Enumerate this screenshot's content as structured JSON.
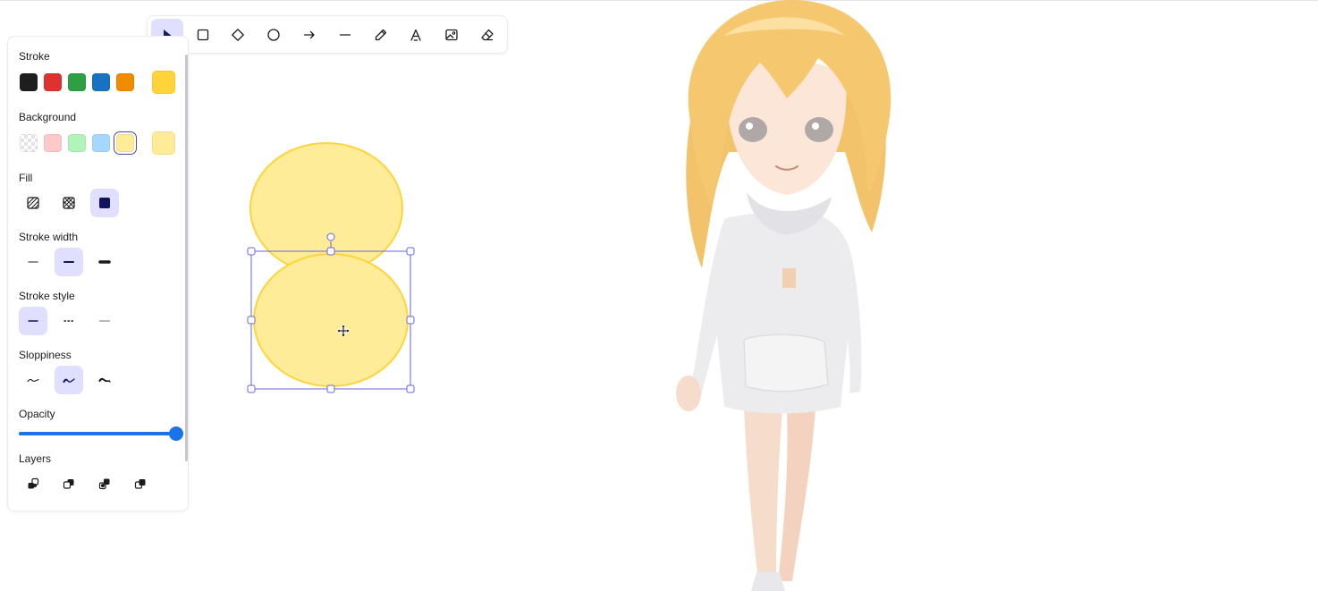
{
  "toolbar": {
    "tools": [
      {
        "name": "selection-icon",
        "active": true
      },
      {
        "name": "rectangle-icon"
      },
      {
        "name": "diamond-icon"
      },
      {
        "name": "ellipse-icon"
      },
      {
        "name": "arrow-icon"
      },
      {
        "name": "line-icon"
      },
      {
        "name": "pencil-icon"
      },
      {
        "name": "text-icon"
      },
      {
        "name": "image-icon"
      },
      {
        "name": "eraser-icon"
      }
    ]
  },
  "panel": {
    "stroke_title": "Stroke",
    "stroke_colors": [
      "#1e1e1e",
      "#e03131",
      "#2f9e44",
      "#1971c2",
      "#f08c00"
    ],
    "stroke_current": "#ffd43b",
    "background_title": "Background",
    "background_colors": [
      "transparent",
      "#ffc9c9",
      "#b2f2bb",
      "#a5d8ff",
      "#ffec99"
    ],
    "background_selected": "#ffec99",
    "background_current": "#ffec99",
    "fill_title": "Fill",
    "fill_options": [
      "hachure",
      "cross-hatch",
      "solid"
    ],
    "fill_selected": "solid",
    "stroke_width_title": "Stroke width",
    "stroke_width_options": [
      "thin",
      "bold",
      "extra-bold"
    ],
    "stroke_width_selected": "bold",
    "stroke_style_title": "Stroke style",
    "stroke_style_options": [
      "solid",
      "dashed",
      "dotted"
    ],
    "stroke_style_selected": "solid",
    "sloppiness_title": "Sloppiness",
    "sloppiness_options": [
      "architect",
      "artist",
      "cartoonist"
    ],
    "sloppiness_selected": "artist",
    "opacity_title": "Opacity",
    "opacity_value": 100,
    "layers_title": "Layers",
    "layer_actions": [
      "send-to-back",
      "send-backward",
      "bring-forward",
      "bring-to-front"
    ]
  },
  "canvas": {
    "ellipse_fill": "#ffec99",
    "ellipse_stroke": "#ffd43b",
    "selection_color": "#6965db"
  }
}
